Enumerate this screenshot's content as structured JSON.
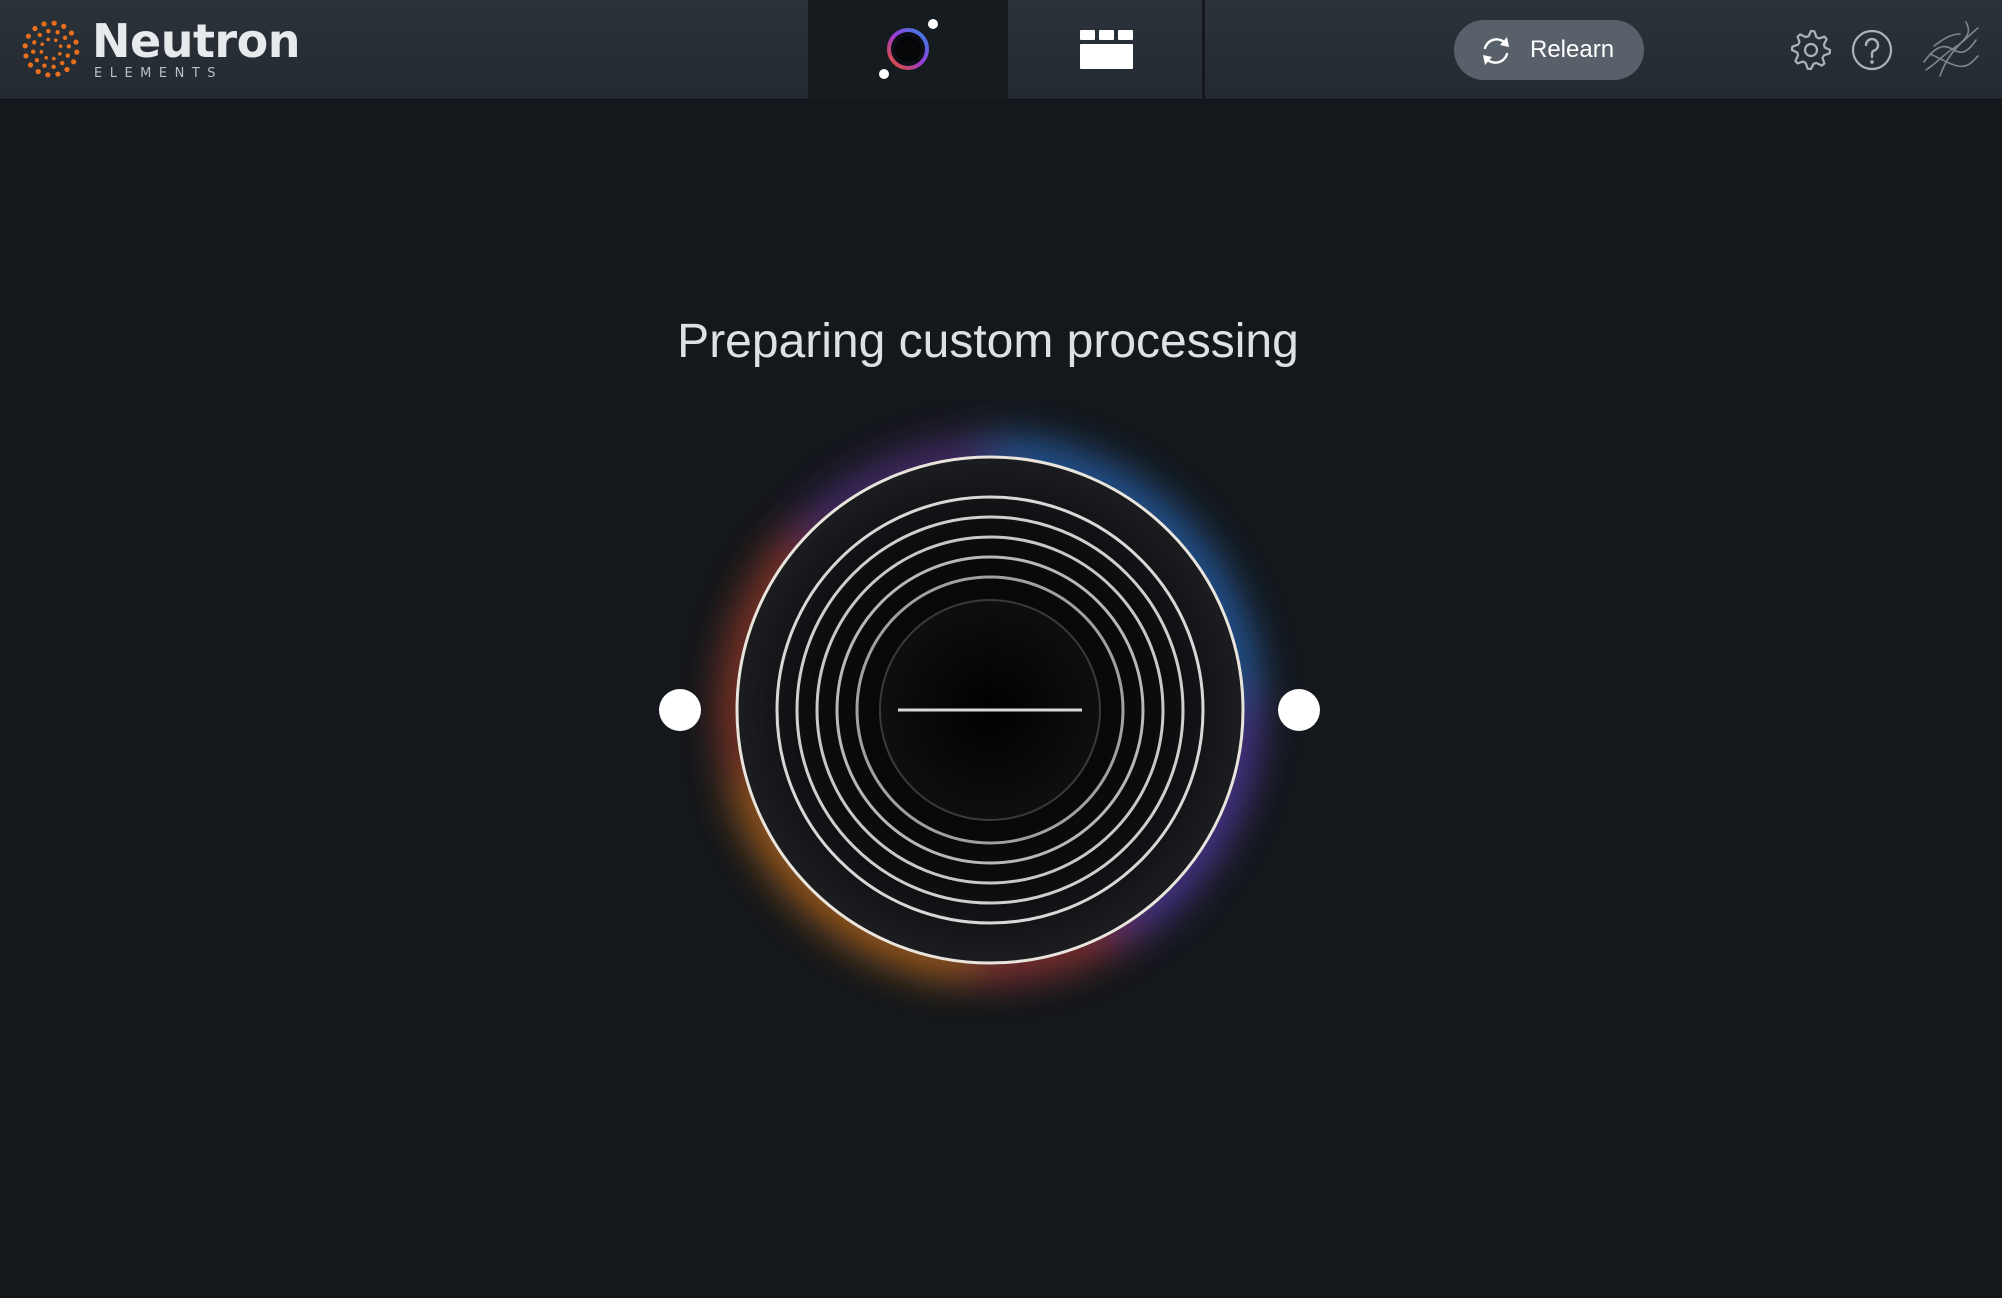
{
  "app": {
    "name": "Neutron",
    "edition": "ELEMENTS",
    "brand_colors": {
      "accent_orange": "#e8701c",
      "header_bg": "#2b3239",
      "app_bg": "#14171b"
    }
  },
  "header": {
    "tabs": [
      {
        "id": "assistant",
        "icon": "assistant-orbit-icon",
        "active": true
      },
      {
        "id": "modules",
        "icon": "modules-grid-icon",
        "active": false
      }
    ],
    "relearn_button": {
      "label": "Relearn",
      "icon": "refresh-arrows-icon"
    },
    "icons": [
      "gear-icon",
      "help-icon",
      "izotope-brand-icon"
    ]
  },
  "main": {
    "status_text": "Preparing custom processing",
    "visualizer": {
      "icon": "listening-rings-icon",
      "glow_colors": [
        "#3a7fd6",
        "#7a4fd9",
        "#d8503a",
        "#e8811c"
      ]
    }
  }
}
